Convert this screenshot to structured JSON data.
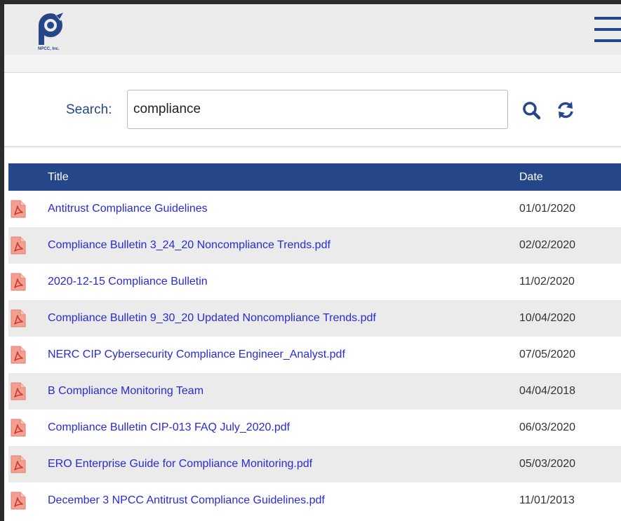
{
  "header": {
    "logo_text": "NPCC, Inc.",
    "brand_color": "#26468a",
    "menu_icon": "hamburger-icon"
  },
  "search": {
    "label": "Search:",
    "value": "compliance",
    "search_icon": "search-icon",
    "refresh_icon": "refresh-icon"
  },
  "table": {
    "headers": {
      "title": "Title",
      "date": "Date"
    },
    "header_color": "#26468a",
    "link_color": "#2a2ad6",
    "file_icon": "pdf-file-icon",
    "rows": [
      {
        "title": "Antitrust Compliance Guidelines",
        "date": "01/01/2020"
      },
      {
        "title": "Compliance Bulletin 3_24_20 Noncompliance Trends.pdf",
        "date": "02/02/2020"
      },
      {
        "title": "2020-12-15 Compliance Bulletin",
        "date": "11/02/2020"
      },
      {
        "title": "Compliance Bulletin 9_30_20 Updated Noncompliance Trends.pdf",
        "date": "10/04/2020"
      },
      {
        "title": "NERC CIP Cybersecurity Compliance Engineer_Analyst.pdf",
        "date": "07/05/2020"
      },
      {
        "title": "B Compliance Monitoring Team",
        "date": "04/04/2018"
      },
      {
        "title": "Compliance Bulletin CIP-013 FAQ July_2020.pdf",
        "date": "06/03/2020"
      },
      {
        "title": "ERO Enterprise Guide for Compliance Monitoring.pdf",
        "date": "05/03/2020"
      },
      {
        "title": "December 3 NPCC Antitrust Compliance Guidelines.pdf",
        "date": "11/01/2013"
      }
    ]
  }
}
